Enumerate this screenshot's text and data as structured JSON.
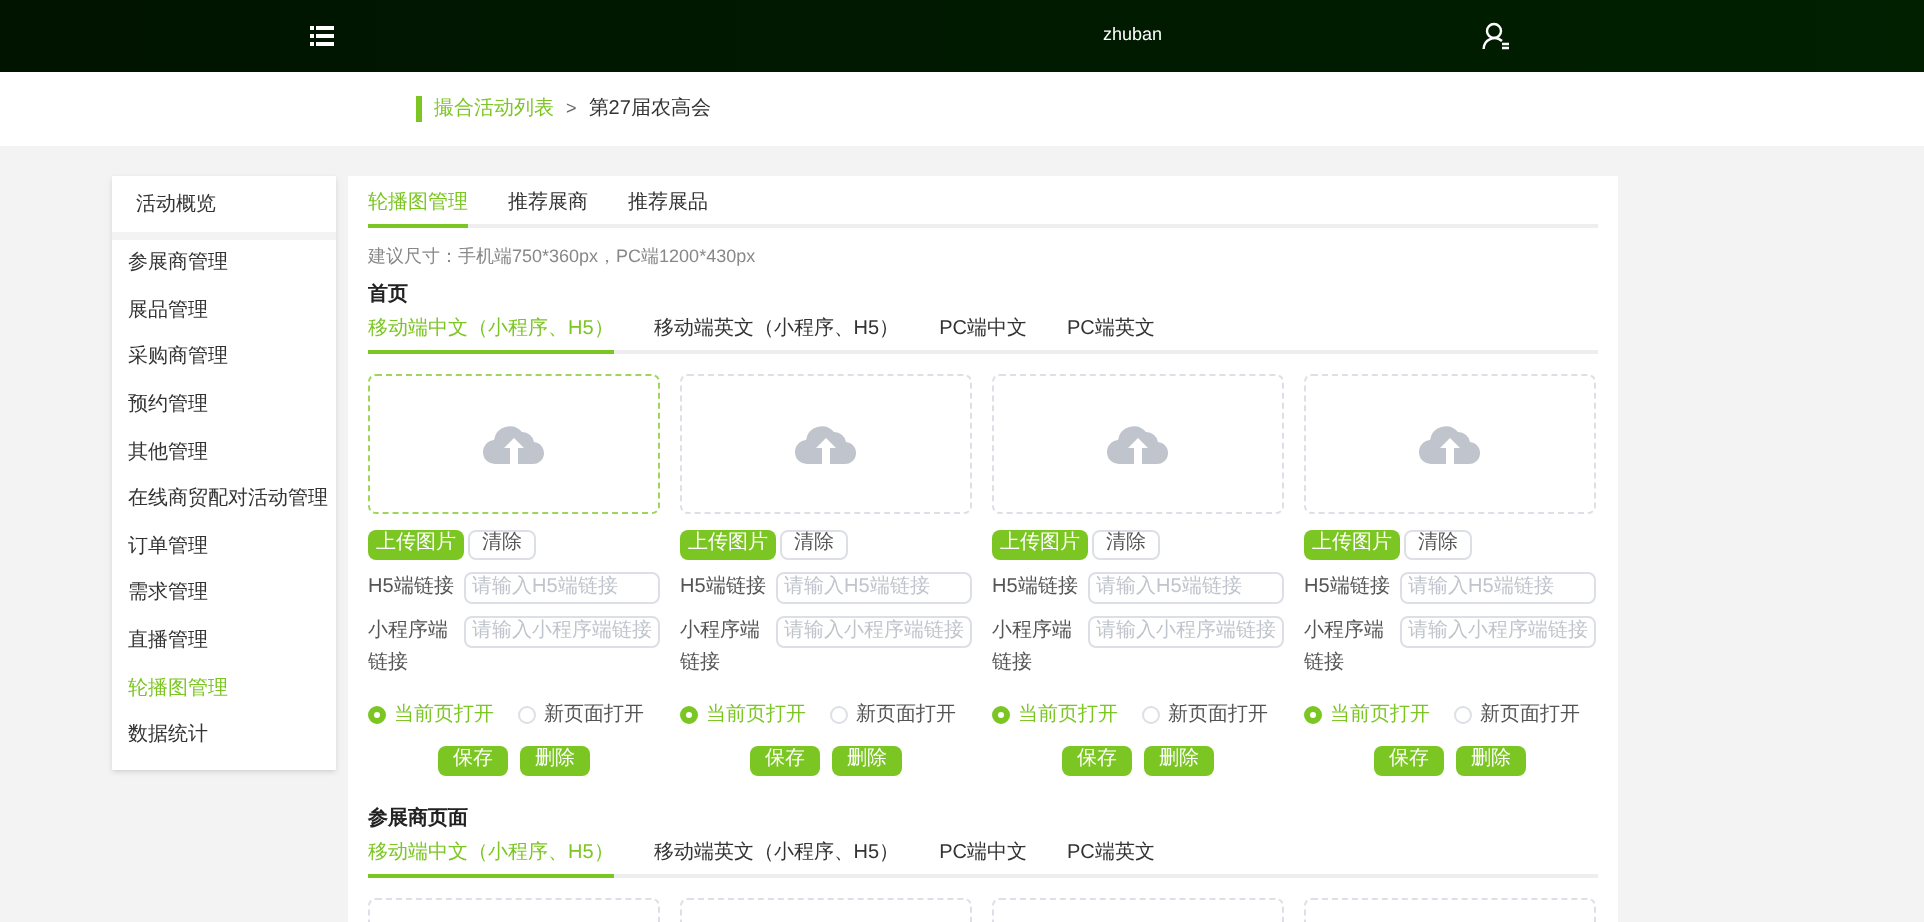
{
  "header": {
    "username": "zhuban"
  },
  "breadcrumb": {
    "items": [
      {
        "label": "撮合活动列表",
        "current": false
      },
      {
        "label": "第27届农高会",
        "current": true
      }
    ],
    "separator": ">"
  },
  "sidebar": {
    "title": "活动概览",
    "items": [
      {
        "label": "参展商管理",
        "selected": false
      },
      {
        "label": "展品管理",
        "selected": false
      },
      {
        "label": "采购商管理",
        "selected": false
      },
      {
        "label": "预约管理",
        "selected": false
      },
      {
        "label": "其他管理",
        "selected": false
      },
      {
        "label": "在线商贸配对活动管理",
        "selected": false
      },
      {
        "label": "订单管理",
        "selected": false
      },
      {
        "label": "需求管理",
        "selected": false
      },
      {
        "label": "直播管理",
        "selected": false
      },
      {
        "label": "轮播图管理",
        "selected": true
      },
      {
        "label": "数据统计",
        "selected": false
      }
    ]
  },
  "tabs": [
    {
      "label": "轮播图管理",
      "selected": true
    },
    {
      "label": "推荐展商",
      "selected": false
    },
    {
      "label": "推荐展品",
      "selected": false
    }
  ],
  "hint": "建议尺寸：手机端750*360px，PC端1200*430px",
  "sections": [
    {
      "title": "首页",
      "tabs": [
        {
          "label": "移动端中文（小程序、H5）",
          "selected": true
        },
        {
          "label": "移动端英文（小程序、H5）",
          "selected": false
        },
        {
          "label": "PC端中文",
          "selected": false
        },
        {
          "label": "PC端英文",
          "selected": false
        }
      ],
      "cards": [
        {
          "highlighted": true,
          "upload_button": "上传图片",
          "clear_button": "清除",
          "fields": [
            {
              "label": "H5端链接",
              "placeholder": "请输入H5端链接"
            },
            {
              "label": "小程序端链接",
              "placeholder": "请输入小程序端链接"
            }
          ],
          "options": [
            {
              "label": "当前页打开",
              "selected": true
            },
            {
              "label": "新页面打开",
              "selected": false
            }
          ],
          "save_button": "保存",
          "delete_button": "删除"
        },
        {
          "highlighted": false,
          "upload_button": "上传图片",
          "clear_button": "清除",
          "fields": [
            {
              "label": "H5端链接",
              "placeholder": "请输入H5端链接"
            },
            {
              "label": "小程序端链接",
              "placeholder": "请输入小程序端链接"
            }
          ],
          "options": [
            {
              "label": "当前页打开",
              "selected": true
            },
            {
              "label": "新页面打开",
              "selected": false
            }
          ],
          "save_button": "保存",
          "delete_button": "删除"
        },
        {
          "highlighted": false,
          "upload_button": "上传图片",
          "clear_button": "清除",
          "fields": [
            {
              "label": "H5端链接",
              "placeholder": "请输入H5端链接"
            },
            {
              "label": "小程序端链接",
              "placeholder": "请输入小程序端链接"
            }
          ],
          "options": [
            {
              "label": "当前页打开",
              "selected": true
            },
            {
              "label": "新页面打开",
              "selected": false
            }
          ],
          "save_button": "保存",
          "delete_button": "删除"
        },
        {
          "highlighted": false,
          "upload_button": "上传图片",
          "clear_button": "清除",
          "fields": [
            {
              "label": "H5端链接",
              "placeholder": "请输入H5端链接"
            },
            {
              "label": "小程序端链接",
              "placeholder": "请输入小程序端链接"
            }
          ],
          "options": [
            {
              "label": "当前页打开",
              "selected": true
            },
            {
              "label": "新页面打开",
              "selected": false
            }
          ],
          "save_button": "保存",
          "delete_button": "删除"
        }
      ]
    },
    {
      "title": "参展商页面",
      "tabs": [
        {
          "label": "移动端中文（小程序、H5）",
          "selected": true
        },
        {
          "label": "移动端英文（小程序、H5）",
          "selected": false
        },
        {
          "label": "PC端中文",
          "selected": false
        },
        {
          "label": "PC端英文",
          "selected": false
        }
      ],
      "cards": [
        {
          "highlighted": false
        },
        {
          "highlighted": false
        },
        {
          "highlighted": false
        },
        {
          "highlighted": false
        }
      ]
    }
  ]
}
